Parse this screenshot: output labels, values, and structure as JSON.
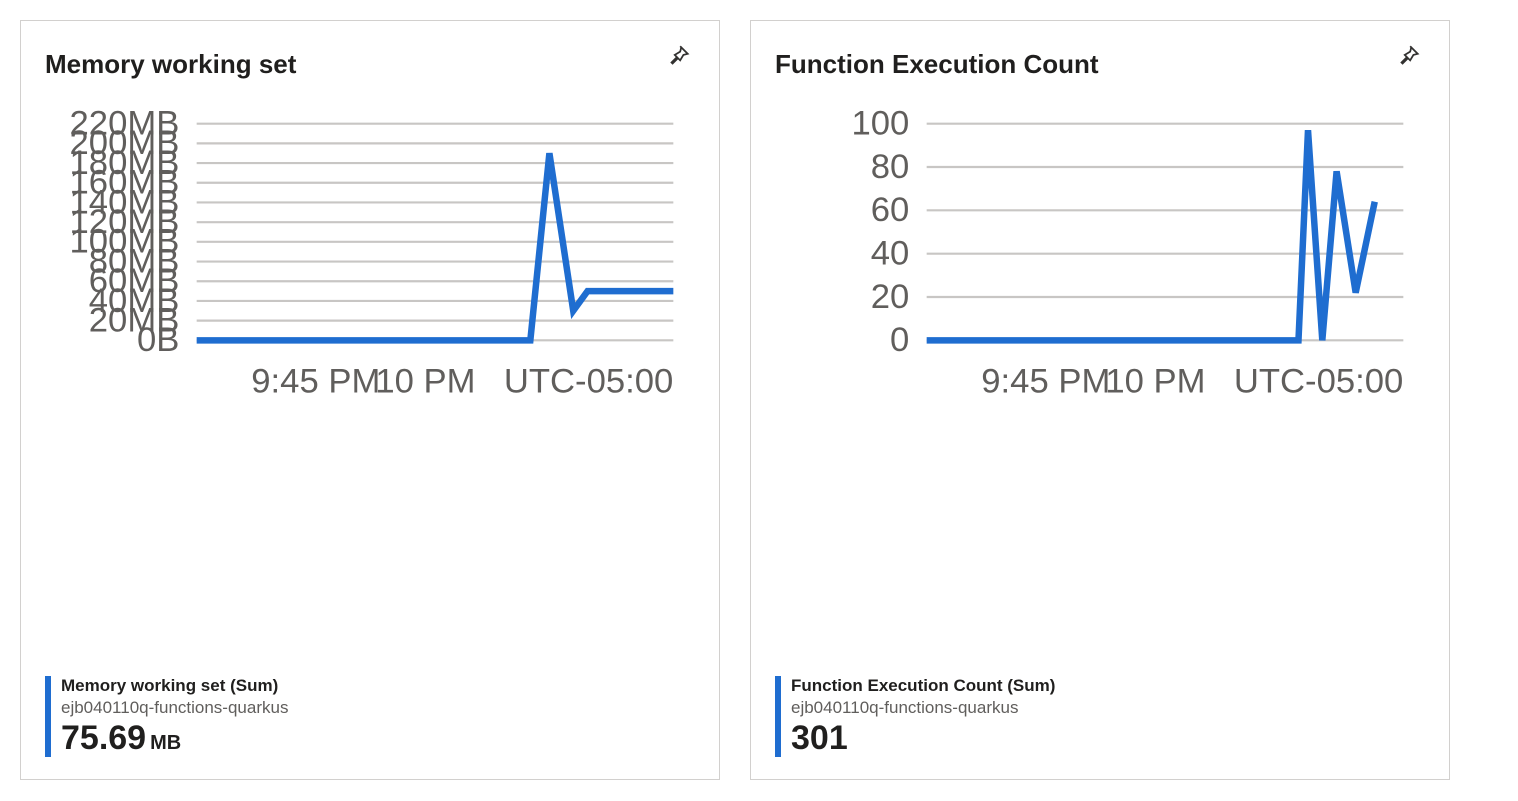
{
  "cards": [
    {
      "title": "Memory working set",
      "legend": {
        "series_name": "Memory working set (Sum)",
        "series_sub": "ejb040110q-functions-quarkus",
        "value": "75.69",
        "unit": "MB"
      },
      "timezone": "UTC-05:00",
      "x_ticks": [
        "9:45 PM",
        "10 PM"
      ],
      "y_axis_labels": [
        "0B",
        "20MB",
        "40MB",
        "60MB",
        "80MB",
        "100MB",
        "120MB",
        "140MB",
        "160MB",
        "180MB",
        "200MB",
        "220MB"
      ]
    },
    {
      "title": "Function Execution Count",
      "legend": {
        "series_name": "Function Execution Count (Sum)",
        "series_sub": "ejb040110q-functions-quarkus",
        "value": "301",
        "unit": ""
      },
      "timezone": "UTC-05:00",
      "x_ticks": [
        "9:45 PM",
        "10 PM"
      ],
      "y_axis_labels": [
        "0",
        "20",
        "40",
        "60",
        "80",
        "100"
      ]
    }
  ],
  "chart_data": [
    {
      "type": "line",
      "title": "Memory working set",
      "xlabel": "",
      "ylabel": "",
      "x_tick_labels": [
        "9:45 PM",
        "10 PM"
      ],
      "ylim": [
        0,
        220
      ],
      "y_unit": "MB",
      "timezone": "UTC-05:00",
      "series": [
        {
          "name": "Memory working set (Sum)",
          "resource": "ejb040110q-functions-quarkus",
          "summary_value": 75.69,
          "summary_unit": "MB",
          "points": [
            {
              "t": 0.0,
              "v": 0
            },
            {
              "t": 0.7,
              "v": 0
            },
            {
              "t": 0.74,
              "v": 190
            },
            {
              "t": 0.79,
              "v": 30
            },
            {
              "t": 0.82,
              "v": 50
            },
            {
              "t": 1.0,
              "v": 50
            }
          ]
        }
      ]
    },
    {
      "type": "line",
      "title": "Function Execution Count",
      "xlabel": "",
      "ylabel": "",
      "x_tick_labels": [
        "9:45 PM",
        "10 PM"
      ],
      "ylim": [
        0,
        100
      ],
      "timezone": "UTC-05:00",
      "series": [
        {
          "name": "Function Execution Count (Sum)",
          "resource": "ejb040110q-functions-quarkus",
          "summary_value": 301,
          "points": [
            {
              "t": 0.0,
              "v": 0
            },
            {
              "t": 0.78,
              "v": 0
            },
            {
              "t": 0.8,
              "v": 97
            },
            {
              "t": 0.83,
              "v": 0
            },
            {
              "t": 0.86,
              "v": 78
            },
            {
              "t": 0.9,
              "v": 22
            },
            {
              "t": 0.94,
              "v": 64
            }
          ]
        }
      ]
    }
  ]
}
